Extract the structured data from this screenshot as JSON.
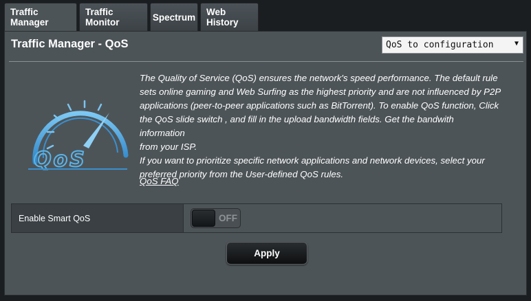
{
  "tabs": [
    {
      "label": "Traffic Manager",
      "active": true
    },
    {
      "label": "Traffic Monitor",
      "active": false
    },
    {
      "label": "Spectrum",
      "active": false
    },
    {
      "label": "Web History",
      "active": false
    }
  ],
  "panel": {
    "title": "Traffic Manager - QoS",
    "mode_select": {
      "value": "QoS to configuration"
    },
    "logo_text": "QoS",
    "description": [
      "The Quality of Service (QoS) ensures the network's speed performance. The default rule",
      "sets online gaming and Web Surfing as the highest priority and are not influenced by P2P",
      "applications (peer-to-peer applications such as BitTorrent). To enable QoS function, Click",
      "the QoS slide switch , and fill in the upload bandwidth fields. Get the bandwith information",
      "from your ISP.",
      "If you want to prioritize specific network applications and network devices, select your",
      "preferred priority from the User-defined QoS rules."
    ],
    "faq_link": "QoS FAQ",
    "smart_qos": {
      "label": "Enable Smart QoS",
      "state": "OFF"
    },
    "apply_button": "Apply"
  },
  "colors": {
    "panel_bg": "#4d5458",
    "logo_blue": "#4aa8e0"
  }
}
